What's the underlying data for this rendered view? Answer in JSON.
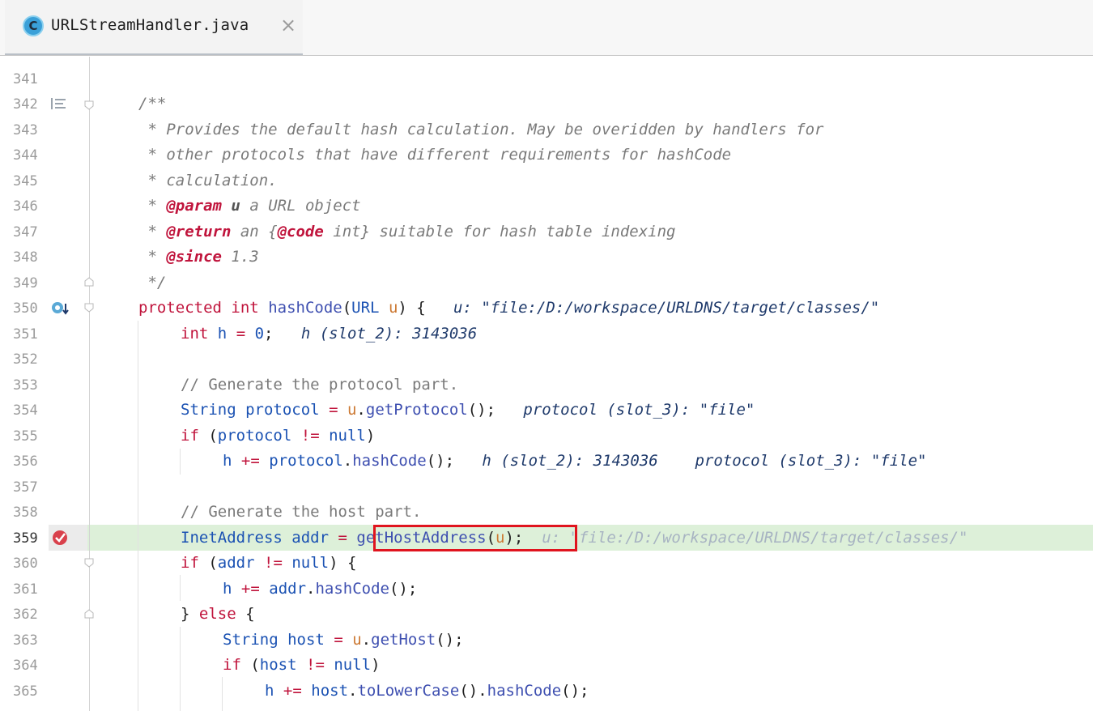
{
  "tab": {
    "icon_letter": "C",
    "filename": "URLStreamHandler.java",
    "close_glyph": "×"
  },
  "gutter": {
    "line_numbers": [
      "341",
      "342",
      "343",
      "344",
      "345",
      "346",
      "347",
      "348",
      "349",
      "350",
      "351",
      "352",
      "353",
      "354",
      "355",
      "356",
      "357",
      "358",
      "359",
      "360",
      "361",
      "362",
      "363",
      "364",
      "365"
    ],
    "current_line": "359"
  },
  "code": {
    "l342": "/**",
    "l343": " * Provides the default hash calculation. May be overidden by handlers for",
    "l344": " * other protocols that have different requirements for hashCode",
    "l345": " * calculation.",
    "l346_pre": " * ",
    "l346_tag": "@param",
    "l346_arg": "u",
    "l346_post": " a URL object",
    "l347_pre": " * ",
    "l347_tag": "@return",
    "l347_mid": " an {",
    "l347_code": "@code",
    "l347_post": " int} suitable for hash table indexing",
    "l348_pre": " * ",
    "l348_tag": "@since",
    "l348_post": " 1.3",
    "l349": " */",
    "l350_kw1": "protected",
    "l350_kw2": "int",
    "l350_name": "hashCode",
    "l350_type": "URL",
    "l350_param": "u",
    "l350_debug": "u: \"file:/D:/workspace/URLDNS/target/classes/\"",
    "l351_kw": "int",
    "l351_var": "h",
    "l351_num": "0",
    "l351_debug": "h (slot_2): 3143036",
    "l353": "// Generate the protocol part.",
    "l354_type": "String",
    "l354_var": "protocol",
    "l354_obj": "u",
    "l354_call": "getProtocol",
    "l354_debug": "protocol (slot_3): \"file\"",
    "l355_kw": "if",
    "l355_var": "protocol",
    "l355_null": "null",
    "l356_var": "h",
    "l356_obj": "protocol",
    "l356_call": "hashCode",
    "l356_debug1": "h (slot_2): 3143036",
    "l356_debug2": "protocol (slot_3): \"file\"",
    "l358": "// Generate the host part.",
    "l359_type": "InetAddress",
    "l359_var": "addr",
    "l359_call": "getHostAddress",
    "l359_arg": "u",
    "l359_debug": "u: \"file:/D:/workspace/URLDNS/target/classes/\"",
    "l360_kw": "if",
    "l360_var": "addr",
    "l360_null": "null",
    "l361_var": "h",
    "l361_obj": "addr",
    "l361_call": "hashCode",
    "l362_kw": "else",
    "l363_type": "String",
    "l363_var": "host",
    "l363_obj": "u",
    "l363_call": "getHost",
    "l364_kw": "if",
    "l364_var": "host",
    "l364_null": "null",
    "l365_var": "h",
    "l365_obj": "host",
    "l365_call1": "toLowerCase",
    "l365_call2": "hashCode"
  },
  "colors": {
    "keyword": "#c0143c",
    "type": "#1b52b3",
    "comment": "#7a7a7a",
    "exec_line_bg": "#ddf0d9",
    "highlight_box": "#e0141e"
  }
}
